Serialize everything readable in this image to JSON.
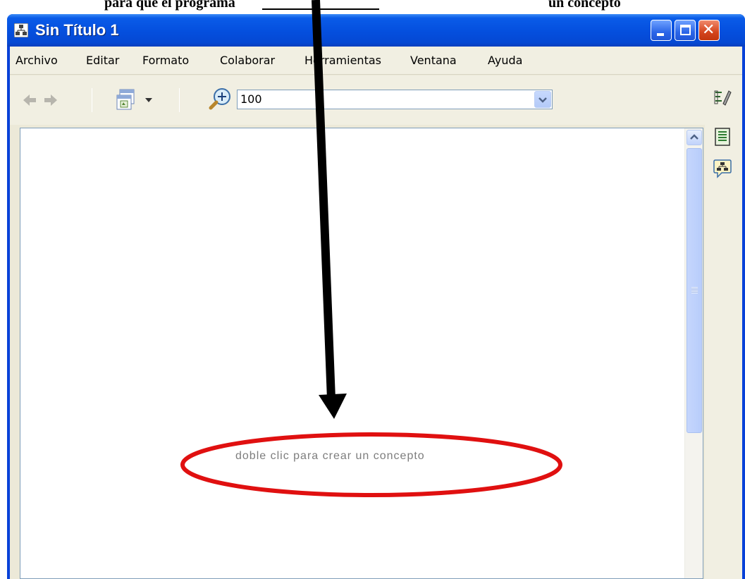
{
  "caption": {
    "left_text": "para que el programa",
    "right_text": "un concepto"
  },
  "window": {
    "title": "Sin Título 1",
    "controls": [
      "minimize-button",
      "maximize-button",
      "close-button"
    ]
  },
  "menubar": {
    "items": [
      {
        "label": "Archivo"
      },
      {
        "label": "Editar"
      },
      {
        "label": "Formato"
      },
      {
        "label": "Colaborar"
      },
      {
        "label": "Herramientas"
      },
      {
        "label": "Ventana"
      },
      {
        "label": "Ayuda"
      }
    ]
  },
  "toolbar": {
    "back_icon": "arrow-left-icon",
    "forward_icon": "arrow-right-icon",
    "view_icon": "window-view-icon",
    "zoom_icon": "zoom-in-icon",
    "zoom_value": "100"
  },
  "canvas": {
    "hint": "doble clic para crear un concepto"
  },
  "annotation": {
    "arrow_color": "#000000",
    "ellipse_color": "#e01010"
  },
  "sidepanel": {
    "icons": [
      "styles-icon",
      "notes-icon",
      "collaboration-icon"
    ]
  },
  "colors": {
    "titlebar": "#0550df",
    "chrome": "#f1efe2",
    "hint_text": "#7d7d7d"
  }
}
